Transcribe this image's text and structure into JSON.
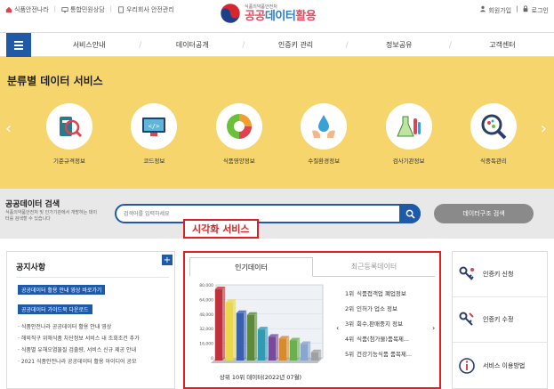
{
  "header": {
    "util_left": [
      "식품안전나라",
      "통합민원상담",
      "우리회사 안전관리"
    ],
    "logo_sub": "식품의약품안전처",
    "logo_prefix": "공공",
    "logo_mid": "데이터",
    "logo_suffix": "활용",
    "util_right": [
      "회원가입",
      "로그인"
    ]
  },
  "nav": {
    "items": [
      "서비스안내",
      "데이터공개",
      "인증키 관리",
      "정보공유",
      "고객센터"
    ]
  },
  "categories": {
    "title": "분류별 데이터 서비스",
    "items": [
      {
        "label": "기준규격정보",
        "icon": "test-tube-magnifier-icon"
      },
      {
        "label": "코드정보",
        "icon": "code-monitor-icon"
      },
      {
        "label": "식품영양정보",
        "icon": "nutrition-pie-icon"
      },
      {
        "label": "수질환경정보",
        "icon": "water-drop-hands-icon"
      },
      {
        "label": "검사기관정보",
        "icon": "lab-flask-icon"
      },
      {
        "label": "식중독관리",
        "icon": "virus-magnifier-icon"
      }
    ]
  },
  "search": {
    "title": "공공데이터 검색",
    "desc": "식품의약품안전처 및 인가기관에서 개방하는 데이터를 검색할 수 있습니다",
    "placeholder": "검색어를 입력하세요",
    "struct_button": "데이터구조 검색"
  },
  "viz_label": "시각화 서비스",
  "notice": {
    "title": "공지사항",
    "plus": "+",
    "tags": [
      "공공데이터 활용 안내 영상 바로가기",
      "공공데이터 가이드북 다운로드"
    ],
    "items": [
      "식품안전나라 공공데이터 활용 안내 영상",
      "해외직구 위해식품 차단정보 서비스 내 조회조건 추가",
      "식품별 유해오염물질 검출량, 서비스 신규 제공 안내",
      "2021 식품안전나라 공공데이터 활용 아이디어 공모"
    ]
  },
  "viz": {
    "tabs": [
      "인기데이터",
      "최근등록데이터"
    ],
    "caption": "상위 10위 데이터(2022년 07월)",
    "rank_prefix": [
      "1위",
      "2위",
      "3위",
      "4위",
      "5위"
    ],
    "ranks": [
      "식품접객업 폐업정보",
      "인허가 업소 정보",
      "회수,판매중지 정보",
      "식품(첨가물)품목제...",
      "건강기능식품 품목제..."
    ],
    "prev": "‹",
    "next": "›"
  },
  "chart_data": {
    "type": "bar",
    "categories": [
      "1",
      "2",
      "3",
      "4",
      "5",
      "6",
      "7",
      "8",
      "9",
      "10"
    ],
    "values": [
      78000,
      64000,
      52000,
      50000,
      34000,
      26000,
      24000,
      22000,
      18000,
      9000
    ],
    "ylim": [
      0,
      80000
    ],
    "yticks": [
      "80,000",
      "64,000",
      "48,000",
      "32,000",
      "16,000",
      "0"
    ],
    "colors": [
      "#c0313b",
      "#e8d94a",
      "#3a5fb0",
      "#5c8a3a",
      "#2f9bb5",
      "#7a4a9a",
      "#d98a2a",
      "#6ab04c",
      "#8aa5d0",
      "#a0a0a0"
    ],
    "title": "상위 10위 데이터(2022년 07월)"
  },
  "quick": {
    "items": [
      {
        "label": "인증키 신청",
        "icon": "key-request-icon"
      },
      {
        "label": "인증키 수정",
        "icon": "key-edit-icon"
      },
      {
        "label": "서비스 이용방법",
        "icon": "info-icon"
      }
    ]
  }
}
